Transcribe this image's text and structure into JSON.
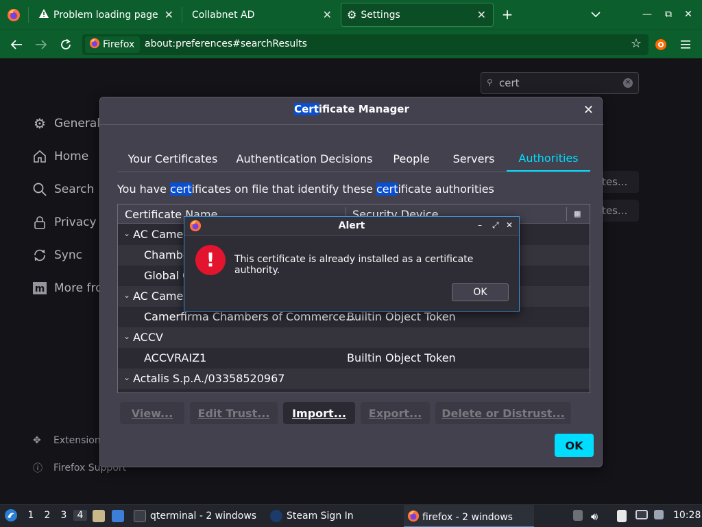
{
  "tabs": [
    {
      "title": "Problem loading page",
      "icon": "warning-icon"
    },
    {
      "title": "Collabnet AD",
      "icon": ""
    },
    {
      "title": "Settings",
      "icon": "gear-icon",
      "active": true
    }
  ],
  "tab_controls": {
    "new_tab": "+",
    "list_all": "⌄",
    "minimize": "—",
    "restore": "⧉",
    "close": "✕"
  },
  "nav": {
    "identity_label": "Firefox",
    "url": "about:preferences#searchResults"
  },
  "preferences": {
    "search_value": "cert",
    "sidebar": [
      {
        "label": "General",
        "icon": "gear-icon"
      },
      {
        "label": "Home",
        "icon": "home-icon"
      },
      {
        "label": "Search",
        "icon": "search-icon"
      },
      {
        "label": "Privacy",
        "icon": "lock-icon"
      },
      {
        "label": "Sync",
        "icon": "sync-icon"
      },
      {
        "label": "More fro",
        "icon": "mozilla-icon"
      }
    ],
    "footer": [
      {
        "label": "Extension",
        "icon": "puzzle-icon"
      },
      {
        "label": "Firefox Support",
        "icon": "help-icon"
      }
    ],
    "bg_buttons": [
      "tes...",
      "tes..."
    ]
  },
  "cert_manager": {
    "title_highlight": "Cert",
    "title_rest": "ificate Manager",
    "tabs": [
      "Your Certificates",
      "Authentication Decisions",
      "People",
      "Servers",
      "Authorities"
    ],
    "selected_tab": "Authorities",
    "description": {
      "p1": "You have ",
      "h1": "cert",
      "p2": "ificates on file that identify these ",
      "h2": "cert",
      "p3": "ificate authorities"
    },
    "columns": [
      "Certificate Name",
      "Security Device"
    ],
    "rows": [
      {
        "name": "AC Camer",
        "device": "",
        "group": true
      },
      {
        "name": "Chambe",
        "device": "",
        "group": false
      },
      {
        "name": "Global C",
        "device": "",
        "group": false
      },
      {
        "name": "AC Camer",
        "device": "",
        "group": true
      },
      {
        "name": "Camerfirma Chambers of Commerce...",
        "device": "Builtin Object Token",
        "group": false
      },
      {
        "name": "ACCV",
        "device": "",
        "group": true
      },
      {
        "name": "ACCVRAIZ1",
        "device": "Builtin Object Token",
        "group": false
      },
      {
        "name": "Actalis S.p.A./03358520967",
        "device": "",
        "group": true
      }
    ],
    "buttons": [
      {
        "label": "View...",
        "enabled": false
      },
      {
        "label": "Edit Trust...",
        "enabled": false
      },
      {
        "label": "Import...",
        "enabled": true
      },
      {
        "label": "Export...",
        "enabled": false
      },
      {
        "label": "Delete or Distrust...",
        "enabled": false
      }
    ],
    "ok_label": "OK"
  },
  "alert": {
    "title": "Alert",
    "message": "This certificate is already installed as a certificate authority.",
    "ok_label": "OK",
    "window_controls": [
      "–",
      "⤢",
      "✕"
    ]
  },
  "taskbar": {
    "workspaces": [
      "1",
      "2",
      "3",
      "4"
    ],
    "current_workspace": "4",
    "tasks": [
      {
        "label": "qterminal - 2 windows",
        "icon": "terminal-icon"
      },
      {
        "label": "Steam Sign In",
        "icon": "steam-icon"
      },
      {
        "label": "firefox - 2 windows",
        "icon": "firefox-icon"
      }
    ],
    "clock": "10:28"
  },
  "colors": {
    "accent": "#00ddff",
    "toolbar": "#0c5f2d",
    "alert_icon": "#e3142d",
    "highlight": "#0a4fd1"
  }
}
